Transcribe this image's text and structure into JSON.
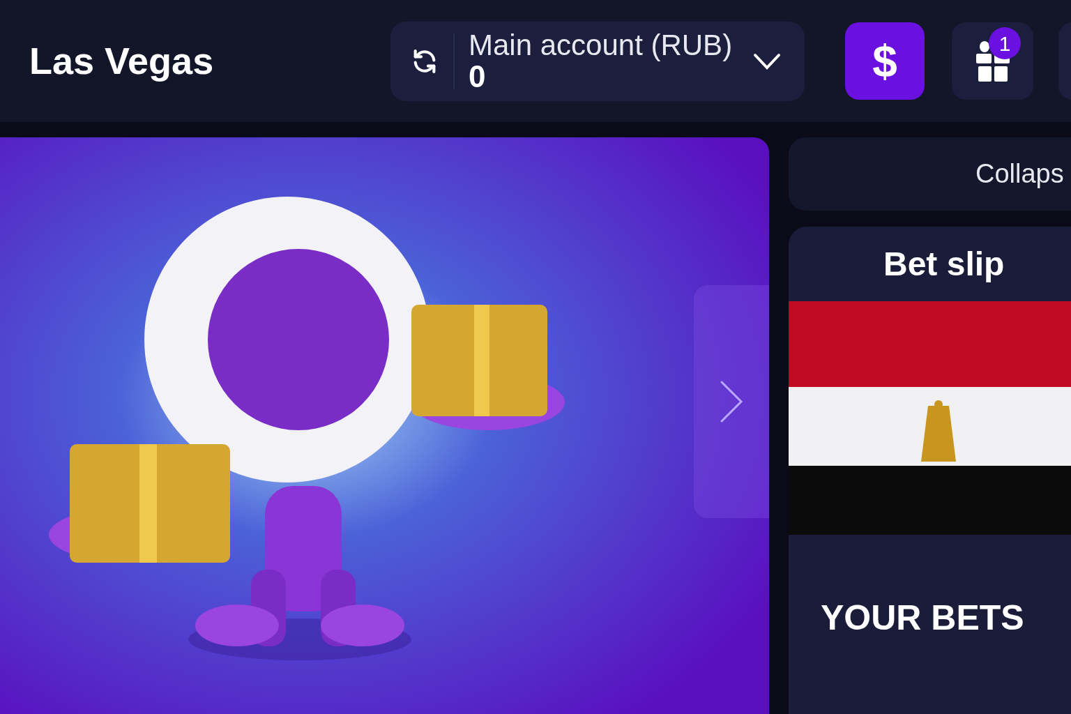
{
  "header": {
    "title": "Las Vegas",
    "account": {
      "label": "Main account (RUB)",
      "balance": "0"
    },
    "deposit_button": "$",
    "gift_badge": "1"
  },
  "sidebar": {
    "collapse_button": "Collaps",
    "bet_slip": {
      "title": "Bet slip",
      "your_bets": "YOUR BETS"
    }
  }
}
